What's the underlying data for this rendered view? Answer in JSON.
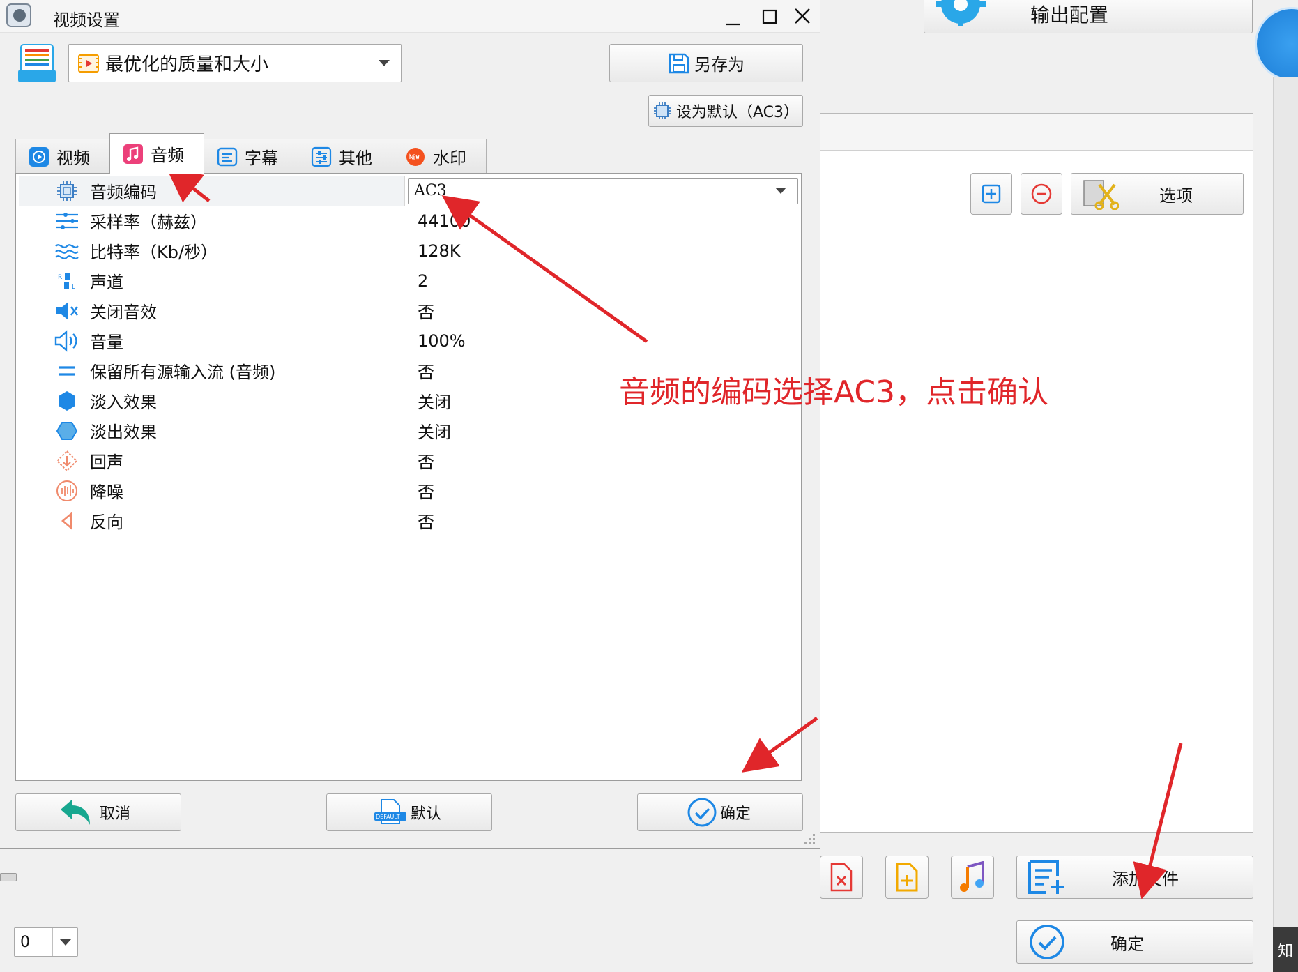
{
  "background": {
    "output_config_label": "输出配置",
    "options_label": "选项",
    "add_file_label": "添加文件",
    "ok_label": "确定",
    "count_value": "0",
    "edge_char": "知"
  },
  "dialog": {
    "title": "视频设置",
    "preset": "最优化的质量和大小",
    "save_as_label": "另存为",
    "set_default_label": "设为默认（AC3）",
    "tabs": [
      {
        "label": "视频"
      },
      {
        "label": "音频"
      },
      {
        "label": "字幕"
      },
      {
        "label": "其他"
      },
      {
        "label": "水印"
      }
    ],
    "rows": [
      {
        "label": "音频编码",
        "value": "AC3"
      },
      {
        "label": "采样率（赫兹）",
        "value": "44100"
      },
      {
        "label": "比特率（Kb/秒）",
        "value": "128K"
      },
      {
        "label": "声道",
        "value": "2"
      },
      {
        "label": "关闭音效",
        "value": "否"
      },
      {
        "label": "音量",
        "value": "100%"
      },
      {
        "label": "保留所有源输入流 (音频)",
        "value": "否"
      },
      {
        "label": "淡入效果",
        "value": "关闭"
      },
      {
        "label": "淡出效果",
        "value": "关闭"
      },
      {
        "label": "回声",
        "value": "否"
      },
      {
        "label": "降噪",
        "value": "否"
      },
      {
        "label": "反向",
        "value": "否"
      }
    ],
    "cancel_label": "取消",
    "default_label": "默认",
    "ok_label": "确定"
  },
  "annotation": {
    "text": "音频的编码选择AC3，点击确认",
    "color": "#e0262a"
  }
}
